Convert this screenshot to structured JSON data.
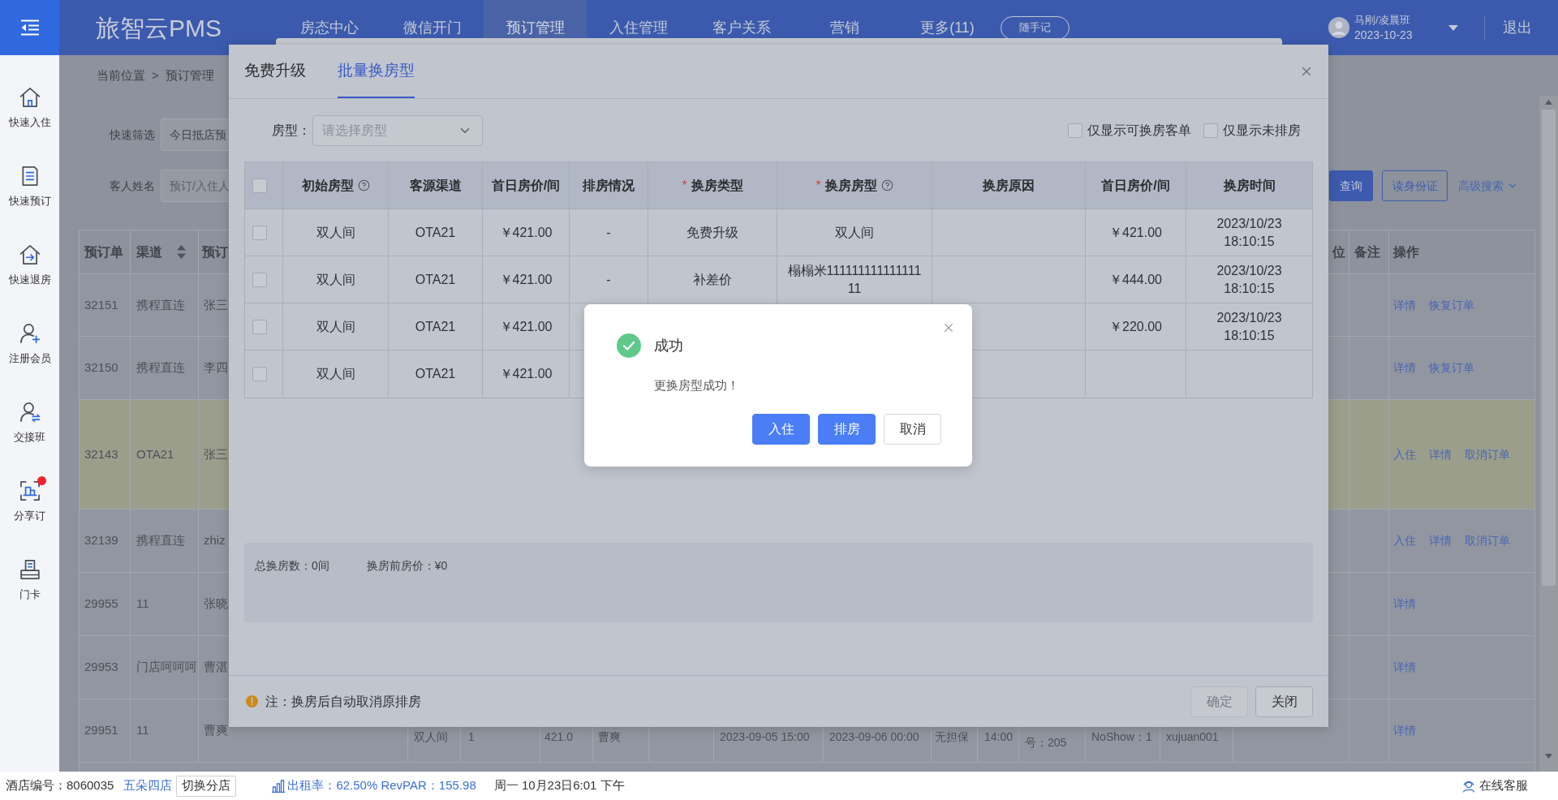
{
  "header": {
    "logo": "旅智云PMS",
    "nav": [
      {
        "label": "房态中心",
        "selected": false
      },
      {
        "label": "微信开门",
        "selected": false
      },
      {
        "label": "预订管理",
        "selected": true
      },
      {
        "label": "入住管理",
        "selected": false
      },
      {
        "label": "客户关系",
        "selected": false
      },
      {
        "label": "营销",
        "selected": false
      },
      {
        "label": "更多(11)",
        "selected": false
      }
    ],
    "memo_button": "随手记",
    "user": {
      "name": "马刚/凌晨班",
      "date": "2023-10-23"
    },
    "logout": "退出"
  },
  "sidebar": {
    "items": [
      {
        "kind": "checkin",
        "label": "快速入住",
        "badge": false
      },
      {
        "kind": "booking",
        "label": "快速预订",
        "badge": false
      },
      {
        "kind": "checkout",
        "label": "快速退房",
        "badge": false
      },
      {
        "kind": "member",
        "label": "注册会员",
        "badge": false
      },
      {
        "kind": "handover",
        "label": "交接班",
        "badge": false
      },
      {
        "kind": "share",
        "label": "分享订",
        "badge": true
      },
      {
        "kind": "card",
        "label": "门卡",
        "badge": false
      }
    ]
  },
  "page": {
    "breadcrumb": {
      "prefix": "当前位置",
      "separator": ">",
      "current": "预订管理"
    },
    "filters": [
      {
        "label": "快速筛选",
        "value": "今日抵店预"
      },
      {
        "label": "客人姓名",
        "placeholder": "预订/入住人"
      }
    ],
    "actions": {
      "search": "查询",
      "read_id": "读身份证",
      "advanced": "高级搜索"
    },
    "table": {
      "columns_left": [
        {
          "label": "预订单",
          "sortable": false
        },
        {
          "label": "渠道",
          "sortable": true
        },
        {
          "label": "预订",
          "sortable": false
        }
      ],
      "columns_right": [
        "位",
        "备注",
        "操作"
      ],
      "rows": [
        {
          "order": "32151",
          "channel": "携程直连",
          "guest": "张三",
          "highlighted": false,
          "links": [
            "详情",
            "恢复订单"
          ]
        },
        {
          "order": "32150",
          "channel": "携程直连",
          "guest": "李四",
          "highlighted": false,
          "links": [
            "详情",
            "恢复订单"
          ]
        },
        {
          "order": "32143",
          "channel": "OTA21",
          "guest": "张三",
          "highlighted": true,
          "links": [
            "入住",
            "详情",
            "取消订单"
          ]
        },
        {
          "order": "32139",
          "channel": "携程直连",
          "guest": "zhiz",
          "highlighted": false,
          "links": [
            "入住",
            "详情",
            "取消订单"
          ]
        },
        {
          "order": "29955",
          "channel": "11",
          "guest": "张晓",
          "highlighted": false,
          "links": [
            "详情"
          ]
        },
        {
          "order": "29953",
          "channel": "门店呵呵呵",
          "guest": "曹湛",
          "highlighted": false,
          "links": [
            "详情"
          ]
        },
        {
          "order": "29951",
          "channel": "11",
          "guest": "曹爽",
          "highlighted": false,
          "links": [
            "详情"
          ],
          "visible_cells": [
            "双人间",
            "1",
            "421.0",
            "曹爽",
            "2023-09-05 15:00",
            "2023-09-06 00:00",
            "无担保",
            "14:00",
            "号：205",
            "NoShow：1",
            "xujuan001"
          ]
        }
      ]
    }
  },
  "modal": {
    "tabs": [
      {
        "label": "免费升级",
        "selected": false
      },
      {
        "label": "批量换房型",
        "selected": true
      }
    ],
    "room_type_filter": {
      "label": "房型：",
      "placeholder": "请选择房型"
    },
    "options": [
      {
        "label": "仅显示可换房客单",
        "checked": false
      },
      {
        "label": "仅显示未排房",
        "checked": false
      }
    ],
    "table": {
      "select_all_checked": false,
      "columns": [
        {
          "label": "初始房型",
          "help": true
        },
        {
          "label": "客源渠道",
          "help": false
        },
        {
          "label": "首日房价/间",
          "help": false
        },
        {
          "label": "排房情况",
          "help": false
        },
        {
          "required_mark": "*",
          "label": "换房类型",
          "help": false
        },
        {
          "required_mark": "*",
          "label": "换房房型",
          "help": true
        },
        {
          "label": "换房原因",
          "help": false
        },
        {
          "label": "首日房价/间",
          "help": false
        },
        {
          "label": "换房时间",
          "help": false
        }
      ],
      "rows": [
        {
          "checked": false,
          "initial_type": "双人间",
          "channel": "OTA21",
          "first_price": "￥421.00",
          "assignment": "-",
          "change_type": "免费升级",
          "new_type": "双人间",
          "new_price": "￥421.00",
          "change_time": "2023/10/23 18:10:15"
        },
        {
          "checked": false,
          "initial_type": "双人间",
          "channel": "OTA21",
          "first_price": "￥421.00",
          "assignment": "-",
          "change_type": "补差价",
          "new_type": "榻榻米11111111111111111",
          "new_price": "￥444.00",
          "change_time": "2023/10/23 18:10:15"
        },
        {
          "checked": false,
          "initial_type": "双人间",
          "channel": "OTA21",
          "first_price": "￥421.00",
          "new_price": "￥220.00",
          "change_time": "2023/10/23 18:10:15"
        },
        {
          "checked": false,
          "initial_type": "双人间",
          "channel": "OTA21",
          "first_price": "￥421.00"
        }
      ]
    },
    "summary": {
      "total_rooms": "总换房数：0间",
      "price_before": "换房前房价：¥0"
    },
    "footer": {
      "note": "注：换房后自动取消原排房",
      "buttons": [
        {
          "label": "确定",
          "disabled": true
        },
        {
          "label": "关闭",
          "disabled": false
        }
      ]
    }
  },
  "success_dialog": {
    "title": "成功",
    "message": "更换房型成功！",
    "buttons": [
      {
        "label": "入住",
        "kind": "primary"
      },
      {
        "label": "排房",
        "kind": "primary"
      },
      {
        "label": "取消",
        "kind": "plain"
      }
    ]
  },
  "status_bar": {
    "hotel": "酒店编号：8060035",
    "branch": "五朵四店",
    "switch_branch": "切换分店",
    "occupancy": "出租率：62.50% RevPAR：155.98",
    "datetime": "周一 10月23日6:01 下午",
    "support": "在线客服"
  }
}
